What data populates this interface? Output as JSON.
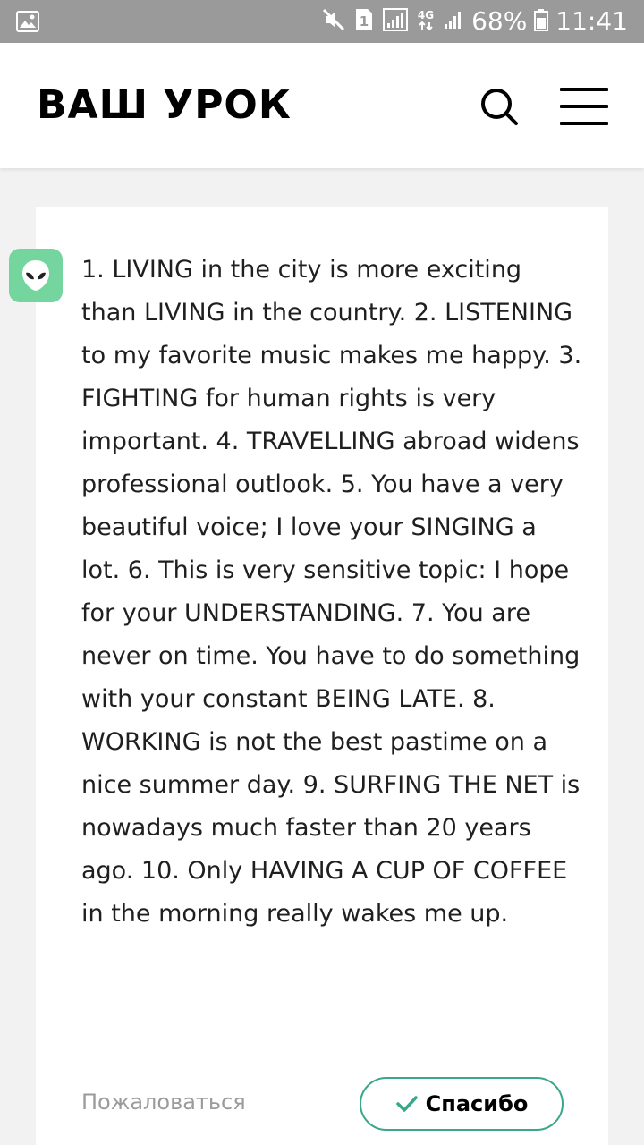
{
  "status_bar": {
    "network": "4G",
    "sim": "1",
    "battery": "68%",
    "time": "11:41",
    "icons": [
      "image-icon",
      "mute-icon",
      "sim-icon",
      "signal-icon",
      "battery-icon"
    ]
  },
  "header": {
    "logo": "ВАШ УРОК",
    "icons": [
      "search-icon",
      "menu-icon"
    ]
  },
  "answer": {
    "avatar_icon": "alien-icon",
    "avatar_color": "#74d69e",
    "text": "1. LIVING in the city is more exciting than LIVING in the country. 2. LISTENING to my favorite music makes me happy. 3. FIGHTING for human rights is very important. 4. TRAVELLING abroad widens professional outlook. 5. You have a very beautiful voice; I love your SINGING a lot. 6. This is very sensitive topic: I hope for your UNDERSTANDING. 7. You are never on time. You have to do something with your constant BEING LATE. 8. WORKING is not the best pastime on a nice summer day. 9. SURFING THE NET is nowadays much faster than 20 years ago. 10. Only HAVING A CUP OF COFFEE in the morning really wakes me up.",
    "complain_label": "Пожаловаться",
    "thanks_label": "Спасибо",
    "accent_color": "#3aa78a"
  }
}
